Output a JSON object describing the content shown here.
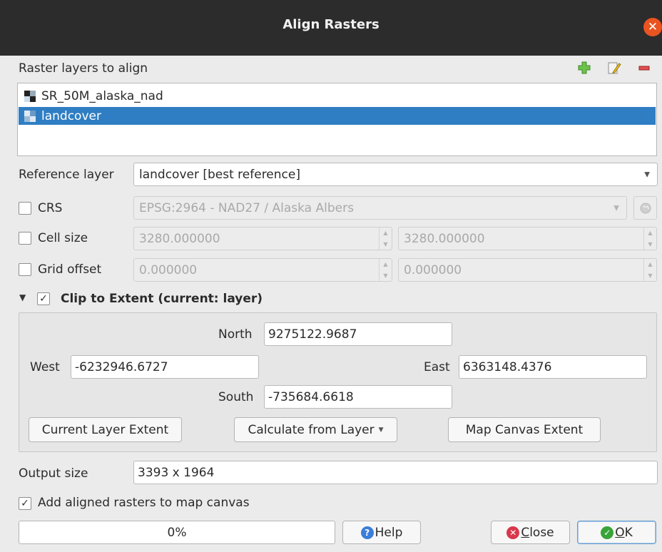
{
  "window": {
    "title": "Align Rasters"
  },
  "layers_section": {
    "label": "Raster layers to align",
    "layers": [
      {
        "name": "SR_50M_alaska_nad",
        "selected": false
      },
      {
        "name": "landcover",
        "selected": true
      }
    ]
  },
  "reference": {
    "label": "Reference layer",
    "value": "landcover [best reference]"
  },
  "crs": {
    "label": "CRS",
    "checked": false,
    "value": "EPSG:2964 - NAD27 / Alaska Albers"
  },
  "cell_size": {
    "label": "Cell size",
    "checked": false,
    "x": "3280.000000",
    "y": "3280.000000"
  },
  "grid_offset": {
    "label": "Grid offset",
    "checked": false,
    "x": "0.000000",
    "y": "0.000000"
  },
  "clip": {
    "label": "Clip to Extent (current: layer)",
    "checked": true,
    "north_label": "North",
    "north": "9275122.9687",
    "west_label": "West",
    "west": "-6232946.6727",
    "east_label": "East",
    "east": "6363148.4376",
    "south_label": "South",
    "south": "-735684.6618",
    "current_layer_button": "Current Layer Extent",
    "calc_from_layer_button": "Calculate from Layer",
    "map_canvas_button": "Map Canvas Extent"
  },
  "output": {
    "label": "Output size",
    "value": "3393 x 1964"
  },
  "add_to_canvas": {
    "label": "Add aligned rasters to map canvas",
    "checked": true
  },
  "progress": {
    "text": "0%",
    "value": 0
  },
  "buttons": {
    "help": "Help",
    "close_first": "C",
    "close_rest": "lose",
    "ok_first": "O",
    "ok_rest": "K"
  },
  "colors": {
    "accent": "#2f7ec3",
    "close": "#e95420",
    "ok": "#3aa33a",
    "help": "#3b7dd8"
  }
}
